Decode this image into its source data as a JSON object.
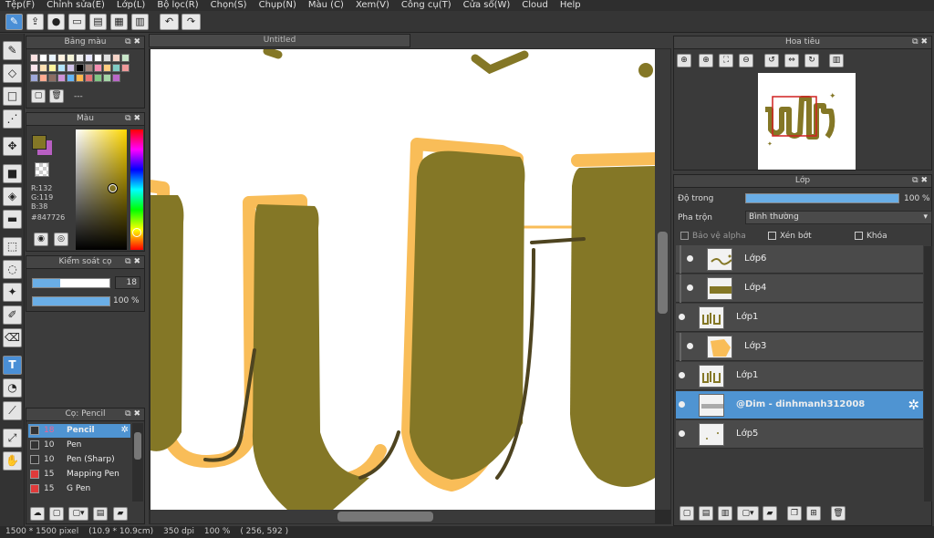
{
  "menu": [
    "Tệp(F)",
    "Chỉnh sửa(E)",
    "Lớp(L)",
    "Bộ lọc(R)",
    "Chọn(S)",
    "Chụp(N)",
    "Màu (C)",
    "Xem(V)",
    "Công cụ(T)",
    "Cửa sổ(W)",
    "Cloud",
    "Help"
  ],
  "canvas": {
    "tab_title": "Untitled"
  },
  "panels": {
    "palette_title": "Bảng màu",
    "palette_name": "---",
    "color_title": "Màu",
    "color": {
      "r": "R:132",
      "g": "G:119",
      "b": "B:38",
      "hex": "#847726",
      "fg": "#847726",
      "bg": "#b85fc2"
    },
    "brush_control_title": "Kiểm soát cọ",
    "brush_size": "18",
    "brush_opacity": "100 %",
    "brush_title": "Cọ: Pencil",
    "brushes": [
      {
        "size": "18",
        "name": "Pencil",
        "color": "#333333",
        "active": true
      },
      {
        "size": "10",
        "name": "Pen",
        "color": "#333333"
      },
      {
        "size": "10",
        "name": "Pen (Sharp)",
        "color": "#333333"
      },
      {
        "size": "15",
        "name": "Mapping Pen",
        "color": "#e03a3a"
      },
      {
        "size": "15",
        "name": "G Pen",
        "color": "#e03a3a"
      }
    ]
  },
  "navigator": {
    "title": "Hoa tiêu"
  },
  "layers_panel": {
    "title": "Lớp",
    "opacity_label": "Độ trong",
    "opacity_value": "100 %",
    "opacity_fraction": 1.0,
    "blend_label": "Pha trộn",
    "blend_value": "Bình thường",
    "protect_alpha": "Bảo vệ alpha",
    "clipping": "Xén bớt",
    "lock": "Khóa",
    "layers": [
      {
        "name": "Lớp6",
        "indent": true,
        "selected": false
      },
      {
        "name": "Lớp4",
        "indent": true,
        "selected": false
      },
      {
        "name": "Lớp1",
        "indent": false,
        "selected": false
      },
      {
        "name": "Lớp3",
        "indent": true,
        "selected": false
      },
      {
        "name": "Lớp1",
        "indent": false,
        "selected": false
      },
      {
        "name": "@Dim - dinhmanh312008",
        "indent": false,
        "selected": true
      },
      {
        "name": "Lớp5",
        "indent": false,
        "selected": false
      }
    ]
  },
  "status": {
    "size_px": "1500 * 1500 pixel",
    "size_cm": "(10.9 * 10.9cm)",
    "dpi": "350 dpi",
    "zoom": "100 %",
    "coords": "( 256, 592 )"
  },
  "colors": {
    "ink": "#847726",
    "ink_dark": "#4e4420",
    "outline": "#f9bd58",
    "selected": "#4f94d2"
  }
}
